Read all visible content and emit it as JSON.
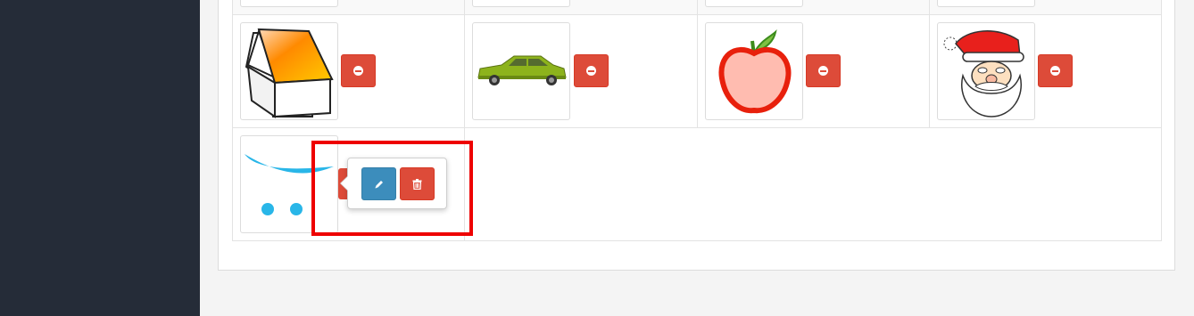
{
  "colors": {
    "sidebar": "#252c38",
    "primary": "#3c8dbc",
    "danger": "#dd4b39",
    "highlight": "#ee0000"
  },
  "images": [
    {
      "name": "house",
      "icon": "house-image"
    },
    {
      "name": "car",
      "icon": "car-image"
    },
    {
      "name": "apple",
      "icon": "apple-image"
    },
    {
      "name": "santa",
      "icon": "santa-image"
    },
    {
      "name": "cart",
      "icon": "cart-logo-image"
    }
  ],
  "actions": {
    "remove": "minus-circle-icon",
    "edit": "pencil-icon",
    "delete": "trash-icon"
  }
}
